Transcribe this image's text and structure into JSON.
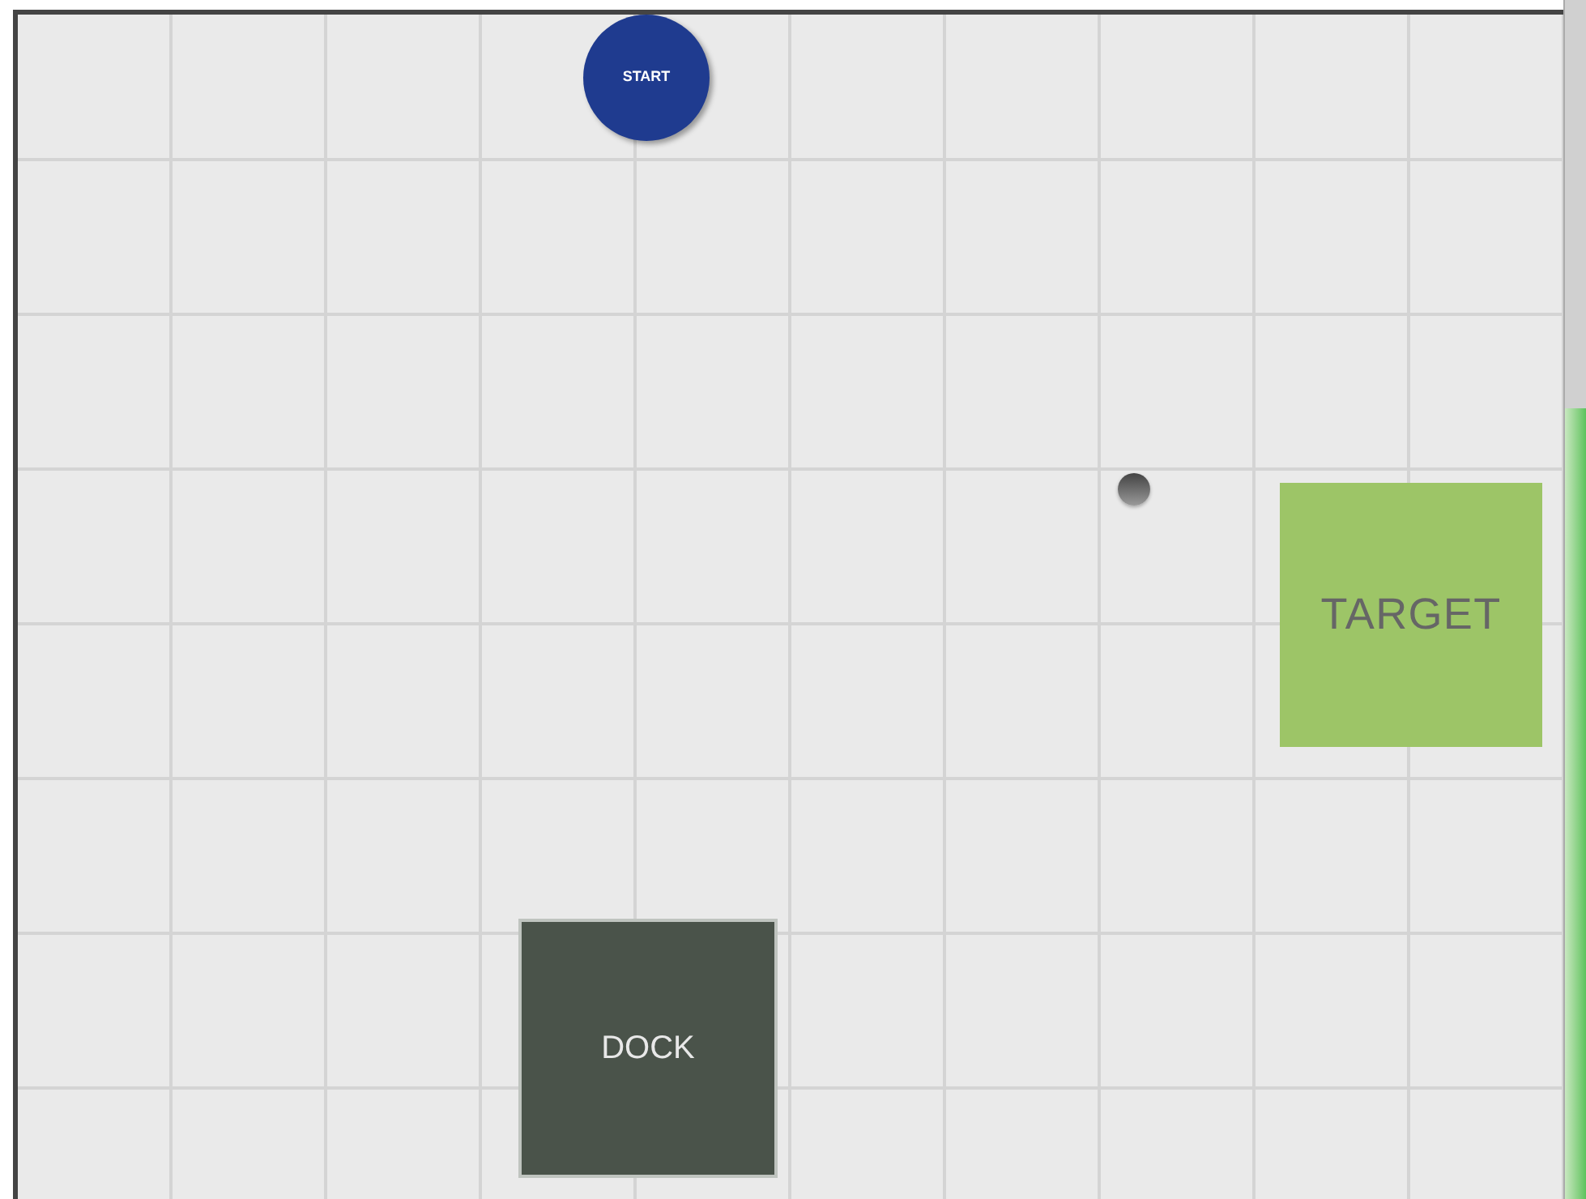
{
  "canvas": {
    "items": [
      {
        "kind": "start",
        "label": "START"
      },
      {
        "kind": "ball"
      },
      {
        "kind": "target",
        "label": "TARGET"
      },
      {
        "kind": "dock",
        "label": "DOCK"
      }
    ]
  },
  "progress": {
    "level": 0.66
  }
}
